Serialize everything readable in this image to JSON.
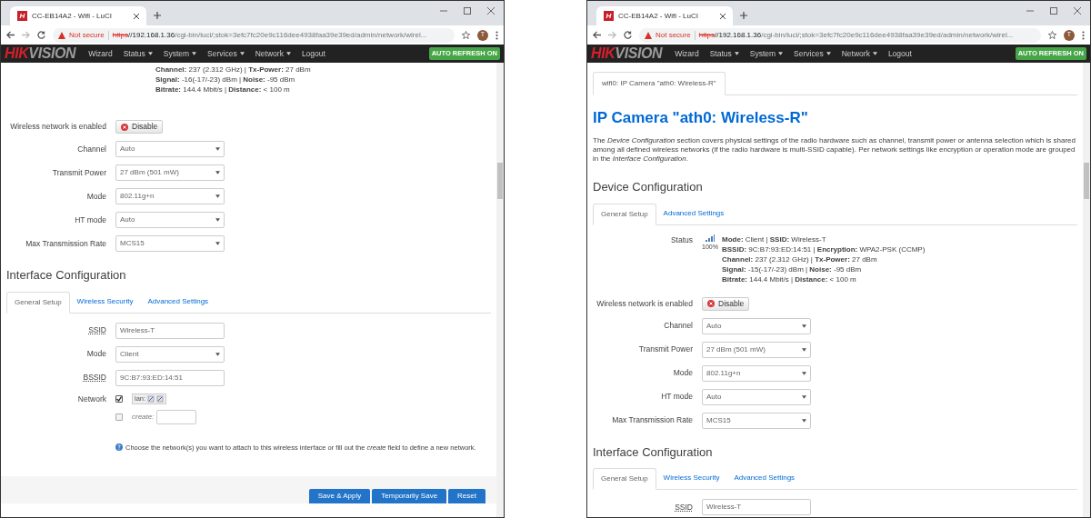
{
  "windows": [
    {
      "tab_title": "CC-EB14A2 - Wifi - LuCI",
      "favicon_text": "H",
      "address": {
        "warning": "Not secure",
        "scheme": "https",
        "host": "//192.168.1.36",
        "path": "/cgi-bin/luci/;stok=3efc7fc20e9c116dee4938faa39e39ed/admin/network/wirel..."
      },
      "profile_initial": "T",
      "brand": {
        "first": "HIK",
        "second": "VISION"
      },
      "nav": [
        {
          "label": "Wizard",
          "dropdown": false
        },
        {
          "label": "Status",
          "dropdown": true
        },
        {
          "label": "System",
          "dropdown": true
        },
        {
          "label": "Services",
          "dropdown": true
        },
        {
          "label": "Network",
          "dropdown": true
        },
        {
          "label": "Logout",
          "dropdown": false
        }
      ],
      "badge": "AUTO REFRESH ON",
      "content": [
        {
          "kind": "status",
          "lines": [
            "**Channel:** 237 (2.312 GHz) | **Tx-Power:** 27 dBm",
            "**Signal:** -16(-17/-23) dBm | **Noise:** -95 dBm",
            "**Bitrate:** 144.4 Mbit/s | **Distance:** < 100 m"
          ]
        },
        {
          "kind": "button",
          "label": "Wireless network is enabled",
          "button": "Disable"
        },
        {
          "kind": "select",
          "label": "Channel",
          "value": "Auto"
        },
        {
          "kind": "select",
          "label": "Transmit Power",
          "value": "27 dBm (501 mW)"
        },
        {
          "kind": "select",
          "label": "Mode",
          "value": "802.11g+n"
        },
        {
          "kind": "select",
          "label": "HT mode",
          "value": "Auto"
        },
        {
          "kind": "select",
          "label": "Max Transmission Rate",
          "value": "MCS15"
        },
        {
          "kind": "section_title",
          "text": "Interface Configuration"
        },
        {
          "kind": "subtabs",
          "tabs": [
            {
              "label": "General Setup",
              "selected": true
            },
            {
              "label": "Wireless Security",
              "selected": false
            },
            {
              "label": "Advanced Settings",
              "selected": false
            }
          ]
        },
        {
          "kind": "input",
          "label": "SSID",
          "abbr": true,
          "value": "Wireless-T"
        },
        {
          "kind": "select",
          "label": "Mode",
          "value": "Client"
        },
        {
          "kind": "input",
          "label": "BSSID",
          "abbr": true,
          "value": "9C:B7:93:ED:14:51"
        },
        {
          "kind": "network",
          "label": "Network",
          "options": [
            {
              "kind": "interface",
              "text": "lan:",
              "checked": true
            },
            {
              "kind": "create",
              "text": "create:",
              "checked": false
            }
          ]
        },
        {
          "kind": "hint",
          "text": "Choose the network(s) you want to attach to this wireless interface or fill out the *create* field to define a new network."
        },
        {
          "kind": "actions",
          "buttons": [
            "Save & Apply",
            "Temporarily Save",
            "Reset"
          ]
        }
      ]
    },
    {
      "tab_title": "CC-EB14A2 - Wifi - LuCI",
      "favicon_text": "H",
      "address": {
        "warning": "Not secure",
        "scheme": "https",
        "host": "//192.168.1.36",
        "path": "/cgi-bin/luci/;stok=3efc7fc20e9c116dee4938faa39e39ed/admin/network/wirel..."
      },
      "profile_initial": "T",
      "brand": {
        "first": "HIK",
        "second": "VISION"
      },
      "nav": [
        {
          "label": "Wizard",
          "dropdown": false
        },
        {
          "label": "Status",
          "dropdown": true
        },
        {
          "label": "System",
          "dropdown": true
        },
        {
          "label": "Services",
          "dropdown": true
        },
        {
          "label": "Network",
          "dropdown": true
        },
        {
          "label": "Logout",
          "dropdown": false
        }
      ],
      "badge": "AUTO REFRESH ON",
      "content": [
        {
          "kind": "page_tabs",
          "tabs": [
            {
              "label": "wifi0: IP Camera \"ath0: Wireless-R\"",
              "selected": true
            }
          ]
        },
        {
          "kind": "heading",
          "text": "IP Camera \"ath0: Wireless-R\""
        },
        {
          "kind": "paragraph",
          "text": "The *Device Configuration* section covers physical settings of the radio hardware such as channel, transmit power or antenna selection which is shared among all defined wireless networks (if the radio hardware is multi-SSID capable). Per network settings like encryption or operation mode are grouped in the *Interface Configuration*."
        },
        {
          "kind": "section_title",
          "text": "Device Configuration"
        },
        {
          "kind": "subtabs",
          "tabs": [
            {
              "label": "General Setup",
              "selected": true
            },
            {
              "label": "Advanced Settings",
              "selected": false
            }
          ]
        },
        {
          "kind": "status",
          "label": "Status",
          "percent": "100%",
          "lines": [
            "**Mode:** Client | **SSID:** Wireless-T",
            "**BSSID:** 9C:B7:93:ED:14:51 | **Encryption:** WPA2-PSK (CCMP)",
            "**Channel:** 237 (2.312 GHz) | **Tx-Power:** 27 dBm",
            "**Signal:** -15(-17/-23) dBm | **Noise:** -95 dBm",
            "**Bitrate:** 144.4 Mbit/s | **Distance:** < 100 m"
          ]
        },
        {
          "kind": "button",
          "label": "Wireless network is enabled",
          "button": "Disable"
        },
        {
          "kind": "select",
          "label": "Channel",
          "value": "Auto"
        },
        {
          "kind": "select",
          "label": "Transmit Power",
          "value": "27 dBm (501 mW)"
        },
        {
          "kind": "select",
          "label": "Mode",
          "value": "802.11g+n"
        },
        {
          "kind": "select",
          "label": "HT mode",
          "value": "Auto"
        },
        {
          "kind": "select",
          "label": "Max Transmission Rate",
          "value": "MCS15"
        },
        {
          "kind": "section_title",
          "text": "Interface Configuration"
        },
        {
          "kind": "subtabs",
          "tabs": [
            {
              "label": "General Setup",
              "selected": true
            },
            {
              "label": "Wireless Security",
              "selected": false
            },
            {
              "label": "Advanced Settings",
              "selected": false
            }
          ]
        },
        {
          "kind": "input",
          "label": "SSID",
          "abbr": true,
          "value": "Wireless-T"
        }
      ]
    }
  ]
}
